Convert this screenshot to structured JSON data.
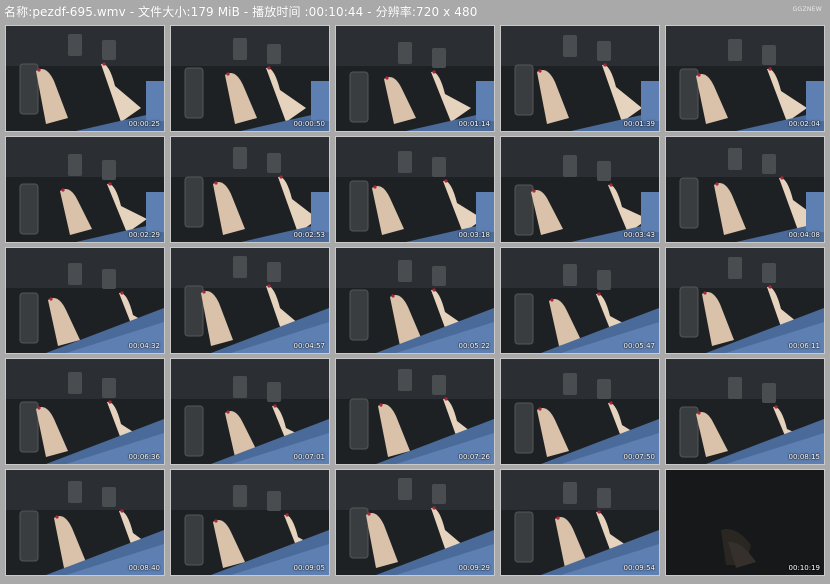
{
  "header": {
    "title": "名称:pezdf-695.wmv - 文件大小:179 MiB - 播放时间 :00:10:44 - 分辨率:720 x 480",
    "watermark": "GGZNEW"
  },
  "thumbnails": [
    {
      "time": "00:00:25"
    },
    {
      "time": "00:00:50"
    },
    {
      "time": "00:01:14"
    },
    {
      "time": "00:01:39"
    },
    {
      "time": "00:02:04"
    },
    {
      "time": "00:02:29"
    },
    {
      "time": "00:02:53"
    },
    {
      "time": "00:03:18"
    },
    {
      "time": "00:03:43"
    },
    {
      "time": "00:04:08"
    },
    {
      "time": "00:04:32"
    },
    {
      "time": "00:04:57"
    },
    {
      "time": "00:05:22"
    },
    {
      "time": "00:05:47"
    },
    {
      "time": "00:06:11"
    },
    {
      "time": "00:06:36"
    },
    {
      "time": "00:07:01"
    },
    {
      "time": "00:07:26"
    },
    {
      "time": "00:07:50"
    },
    {
      "time": "00:08:15"
    },
    {
      "time": "00:08:40"
    },
    {
      "time": "00:09:05"
    },
    {
      "time": "00:09:29"
    },
    {
      "time": "00:09:54"
    },
    {
      "time": "00:10:19"
    }
  ]
}
